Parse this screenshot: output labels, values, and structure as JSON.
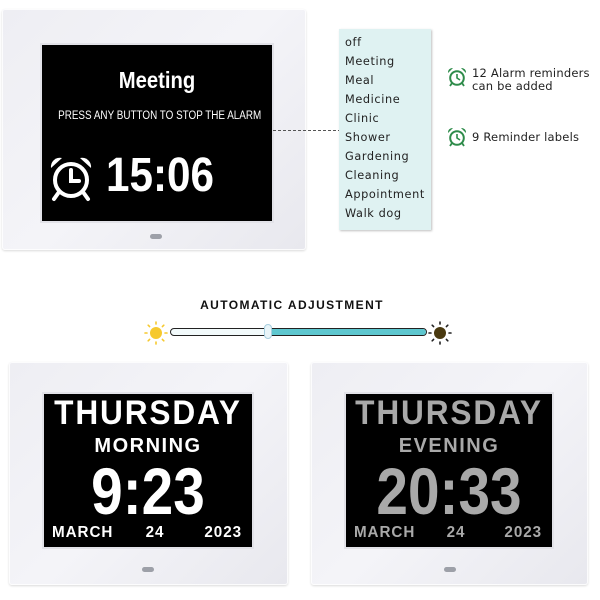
{
  "alarm_display": {
    "label": "Meeting",
    "instruction": "PRESS ANY BUTTON TO STOP THE ALARM",
    "time": "15:06",
    "icon": "alarm-clock-icon"
  },
  "reminder_labels": [
    "off",
    "Meeting",
    "Meal",
    "Medicine",
    "Clinic",
    "Shower",
    "Gardening",
    "Cleaning",
    "Appointment",
    "Walk dog"
  ],
  "features": [
    {
      "icon": "alarm-clock-icon",
      "line1": "12 Alarm reminders",
      "line2": "can be added"
    },
    {
      "icon": "alarm-clock-icon",
      "line1": "9 Reminder labels",
      "line2": ""
    }
  ],
  "auto_adjustment": {
    "title": "AUTOMATIC ADJUSTMENT",
    "brightness_level_percent": 38,
    "left_icon": "sun-bright-icon",
    "right_icon": "sun-dark-icon",
    "colors": {
      "bright": "#f6c92e",
      "dark": "#4a3a10",
      "fill": "#5ec7cf"
    }
  },
  "day_displays": [
    {
      "mode": "morning",
      "day": "THURSDAY",
      "period": "MORNING",
      "time": "9:23",
      "month": "MARCH",
      "date": "24",
      "year": "2023",
      "text_color": "#ffffff"
    },
    {
      "mode": "evening",
      "day": "THURSDAY",
      "period": "EVENING",
      "time": "20:33",
      "month": "MARCH",
      "date": "24",
      "year": "2023",
      "text_color": "#a9a9a9"
    }
  ],
  "colors": {
    "accent_green": "#2e8b4a",
    "label_box_bg": "#dff2f2"
  }
}
